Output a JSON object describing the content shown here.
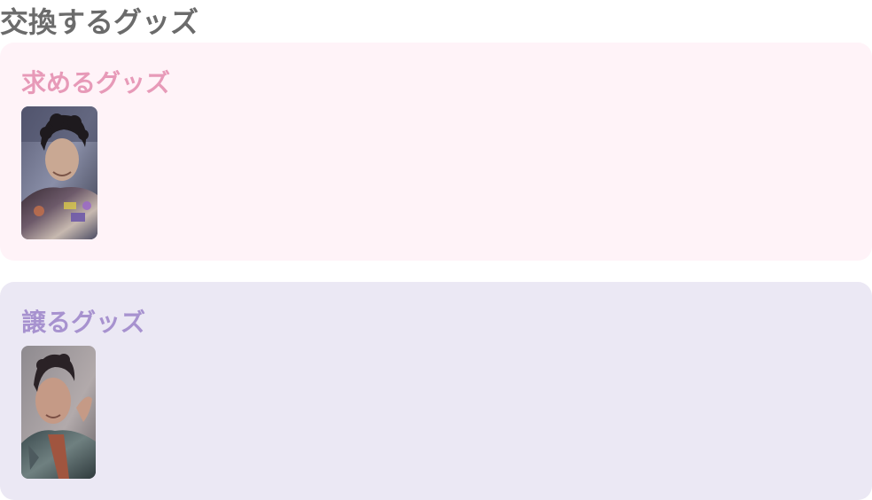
{
  "page": {
    "title": "交換するグッズ"
  },
  "want_section": {
    "label": "求めるグッズ",
    "items": [
      {
        "icon": "photocard-image",
        "accent": "#e79ab8"
      }
    ],
    "background": "#fff3f8"
  },
  "give_section": {
    "label": "譲るグッズ",
    "items": [
      {
        "icon": "photocard-image",
        "accent": "#a792cf"
      }
    ],
    "background": "#ebe8f4"
  }
}
